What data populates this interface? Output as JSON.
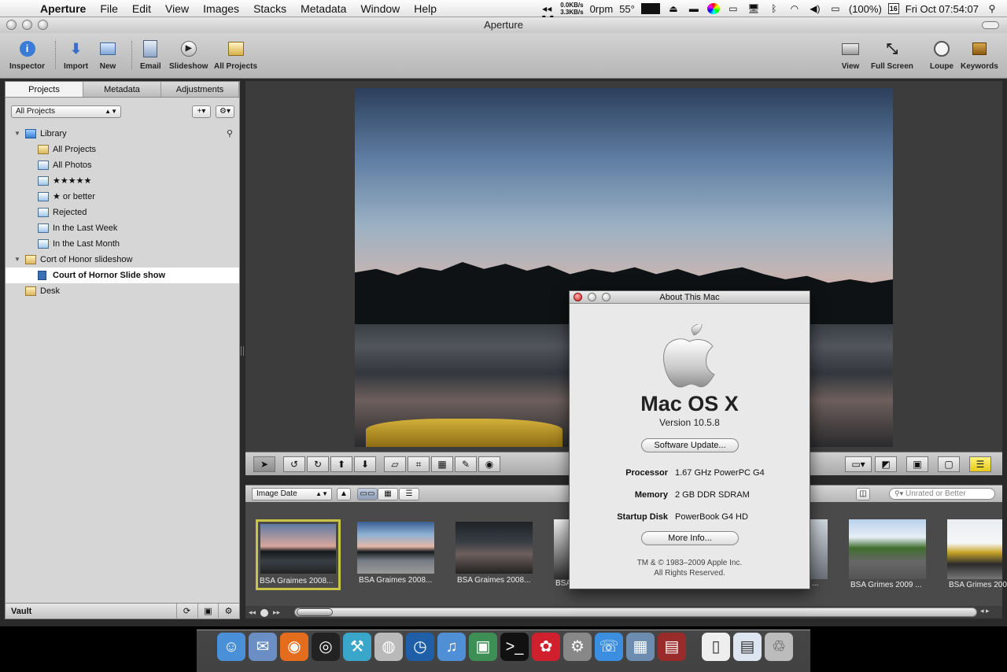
{
  "menubar": {
    "app_name": "Aperture",
    "items": [
      "File",
      "Edit",
      "View",
      "Images",
      "Stacks",
      "Metadata",
      "Window",
      "Help"
    ],
    "net_down": "0.0KB/s",
    "net_up": "3.3KB/s",
    "fan": "0rpm",
    "temp": "55°",
    "battery": "(100%)",
    "calendar_day": "16",
    "clock": "Fri Oct 07:54:07"
  },
  "window": {
    "title": "Aperture"
  },
  "toolbar": {
    "inspector": "Inspector",
    "import": "Import",
    "new": "New",
    "email": "Email",
    "slideshow": "Slideshow",
    "all_projects": "All Projects",
    "view": "View",
    "full_screen": "Full Screen",
    "loupe": "Loupe",
    "keywords": "Keywords"
  },
  "sidebar": {
    "tabs": [
      "Projects",
      "Metadata",
      "Adjustments"
    ],
    "filter": "All Projects",
    "tree": [
      {
        "label": "Library",
        "level": 0,
        "disclosure": "▼",
        "icon": "library"
      },
      {
        "label": "All Projects",
        "level": 1,
        "icon": "project"
      },
      {
        "label": "All Photos",
        "level": 1,
        "icon": "album"
      },
      {
        "label": "★★★★★",
        "level": 1,
        "icon": "album"
      },
      {
        "label": "★ or better",
        "level": 1,
        "icon": "album"
      },
      {
        "label": "Rejected",
        "level": 1,
        "icon": "album"
      },
      {
        "label": "In the Last Week",
        "level": 1,
        "icon": "album"
      },
      {
        "label": "In the Last Month",
        "level": 1,
        "icon": "album"
      },
      {
        "label": "Cort of Honor slideshow",
        "level": 0,
        "disclosure": "▼",
        "icon": "project"
      },
      {
        "label": "Court of Hornor Slide show",
        "level": 1,
        "icon": "slideshow",
        "selected": true
      },
      {
        "label": "Desk",
        "level": 0,
        "icon": "project"
      }
    ],
    "vault": "Vault"
  },
  "browser": {
    "sort": "Image Date",
    "search_placeholder": "Unrated or Better",
    "thumbs": [
      {
        "caption": "BSA Graimes 2008...",
        "selected": true
      },
      {
        "caption": "BSA Graimes 2008..."
      },
      {
        "caption": "BSA Graimes 2008..."
      },
      {
        "caption": "BSA"
      },
      {
        "caption": "..."
      },
      {
        "caption": "BSA Grimes 2009 ..."
      },
      {
        "caption": "BSA Grimes 200"
      }
    ]
  },
  "about": {
    "title": "About This Mac",
    "os_name": "Mac OS X",
    "version": "Version 10.5.8",
    "software_update": "Software Update...",
    "specs": [
      {
        "key": "Processor",
        "value": "1.67 GHz PowerPC G4"
      },
      {
        "key": "Memory",
        "value": "2 GB DDR SDRAM"
      },
      {
        "key": "Startup Disk",
        "value": "PowerBook G4 HD"
      }
    ],
    "more_info": "More Info...",
    "copyright": "TM & © 1983–2009 Apple Inc.",
    "rights": "All Rights Reserved."
  },
  "dock": {
    "apps": [
      "finder",
      "mail",
      "firefox",
      "aperture",
      "xcode",
      "disk-utility",
      "dashboard",
      "itunes",
      "preview",
      "terminal",
      "flower-app",
      "system-preferences",
      "ichat",
      "iphoto",
      "photo-booth",
      "textedit",
      "document",
      "trash"
    ]
  }
}
